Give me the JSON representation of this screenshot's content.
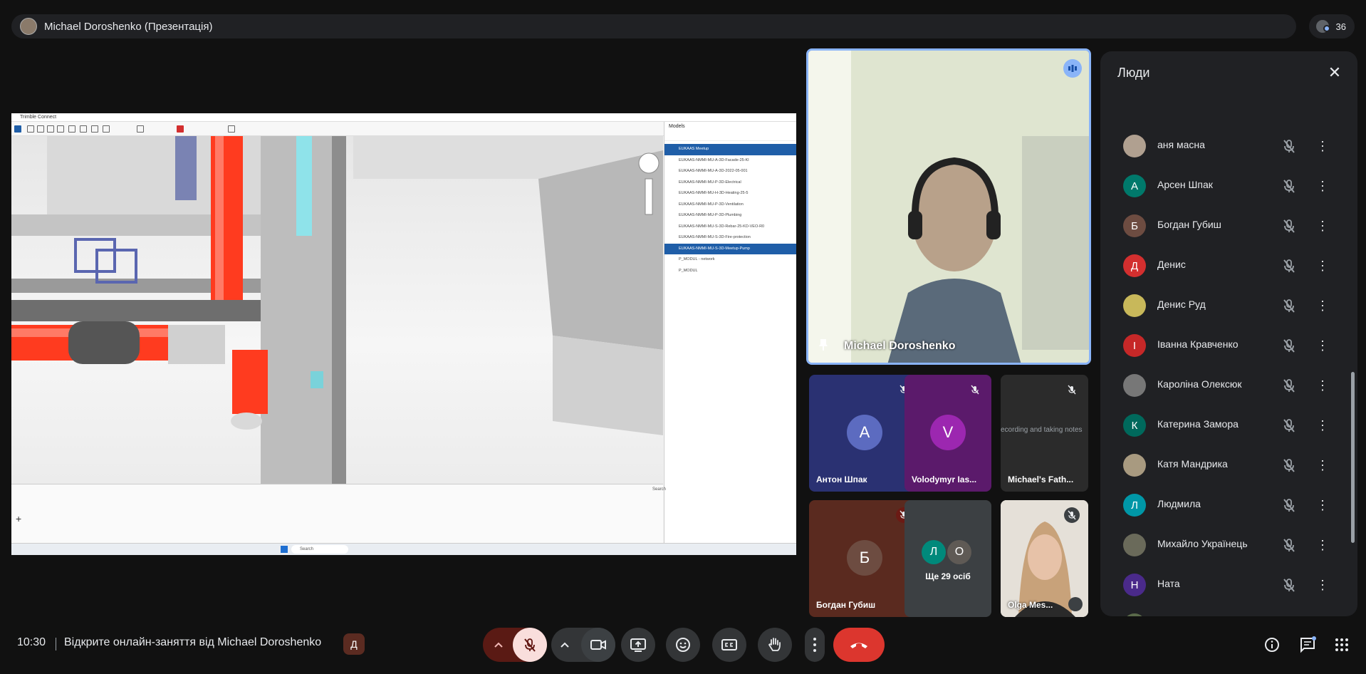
{
  "top_bar": {
    "presenter": "Michael Doroshenko (Презентація)",
    "participant_count": "36"
  },
  "presentation": {
    "app_title": "Trimble Connect",
    "models_header": "Models",
    "model_rows": [
      {
        "label": "EUKAAS Meetup",
        "selected": true
      },
      {
        "label": "EUKAAS-NMMI-MU-A-3D-Facade-25-KI",
        "selected": false
      },
      {
        "label": "EUKAAS-NMMI-MU-A-3D-2022-05-001",
        "selected": false
      },
      {
        "label": "EUKAAS-NMMI-MU-P-3D-Electrical",
        "selected": false
      },
      {
        "label": "EUKAAS-NMMI-MU-H-3D-Heating-25-5",
        "selected": false
      },
      {
        "label": "EUKAAS-NMMI-MU-P-3D-Ventilation",
        "selected": false
      },
      {
        "label": "EUKAAS-NMMI-MU-P-3D-Plumbing",
        "selected": false
      },
      {
        "label": "EUKAAS-NMMI-MU-S-3D-Rebar-25-KD-VEO-R0",
        "selected": false
      },
      {
        "label": "EUKAAS-NMMI-MU-S-3D-Fire-protection",
        "selected": false
      },
      {
        "label": "EUKAAS-NMMI-MU-S-3D-Meetup-Pump",
        "selected": true
      },
      {
        "label": "P_MODUL - network",
        "selected": false
      },
      {
        "label": "P_MODUL",
        "selected": false
      }
    ],
    "search_label": "Search"
  },
  "main_video": {
    "name": "Michael Doroshenko"
  },
  "tiles": [
    {
      "name": "Антон Шпак",
      "initial": "А",
      "bg": "#2a3172",
      "avatar": "#5c6bc0"
    },
    {
      "name": "Volodymyr Ias...",
      "initial": "V",
      "bg": "#5b1a6b",
      "avatar": "#9c27b0"
    },
    {
      "name": "Michael's Fath...",
      "caption": "ecording and taking notes",
      "bg": "#2b2b2b"
    },
    {
      "name": "Богдан Губиш",
      "initial": "Б",
      "bg": "#5a2a1f",
      "avatar": "#6d4c41"
    },
    {
      "more_label": "Ще 29 осіб",
      "initials": [
        "Л",
        "О"
      ]
    },
    {
      "name": "Olga Mes..."
    }
  ],
  "people_panel": {
    "title": "Люди",
    "rows": [
      {
        "name": "аня масна",
        "initial": "",
        "color": "#b0a090"
      },
      {
        "name": "Арсен Шпак",
        "initial": "А",
        "color": "#00796b"
      },
      {
        "name": "Богдан Губиш",
        "initial": "Б",
        "color": "#6d4c41"
      },
      {
        "name": "Денис",
        "initial": "Д",
        "color": "#d32f2f"
      },
      {
        "name": "Денис Руд",
        "initial": "",
        "color": "#c8b85a"
      },
      {
        "name": "Іванна Кравченко",
        "initial": "І",
        "color": "#c62828"
      },
      {
        "name": "Кароліна Олексюк",
        "initial": "",
        "color": "#777777"
      },
      {
        "name": "Катерина Замора",
        "initial": "К",
        "color": "#00695c"
      },
      {
        "name": "Катя Мандрика",
        "initial": "",
        "color": "#a89a80"
      },
      {
        "name": "Людмила",
        "initial": "Л",
        "color": "#0097a7"
      },
      {
        "name": "Михайло Українець",
        "initial": "",
        "color": "#6a6a5a"
      },
      {
        "name": "Ната",
        "initial": "Н",
        "color": "#4a2a8a"
      },
      {
        "name": "Олександр Боднар",
        "initial": "",
        "color": "#5a6a4a"
      }
    ]
  },
  "bottom_bar": {
    "time": "10:30",
    "meeting_title": "Відкрите онлайн-заняття від Michael Doroshenko",
    "meeting_badge": "Д"
  }
}
